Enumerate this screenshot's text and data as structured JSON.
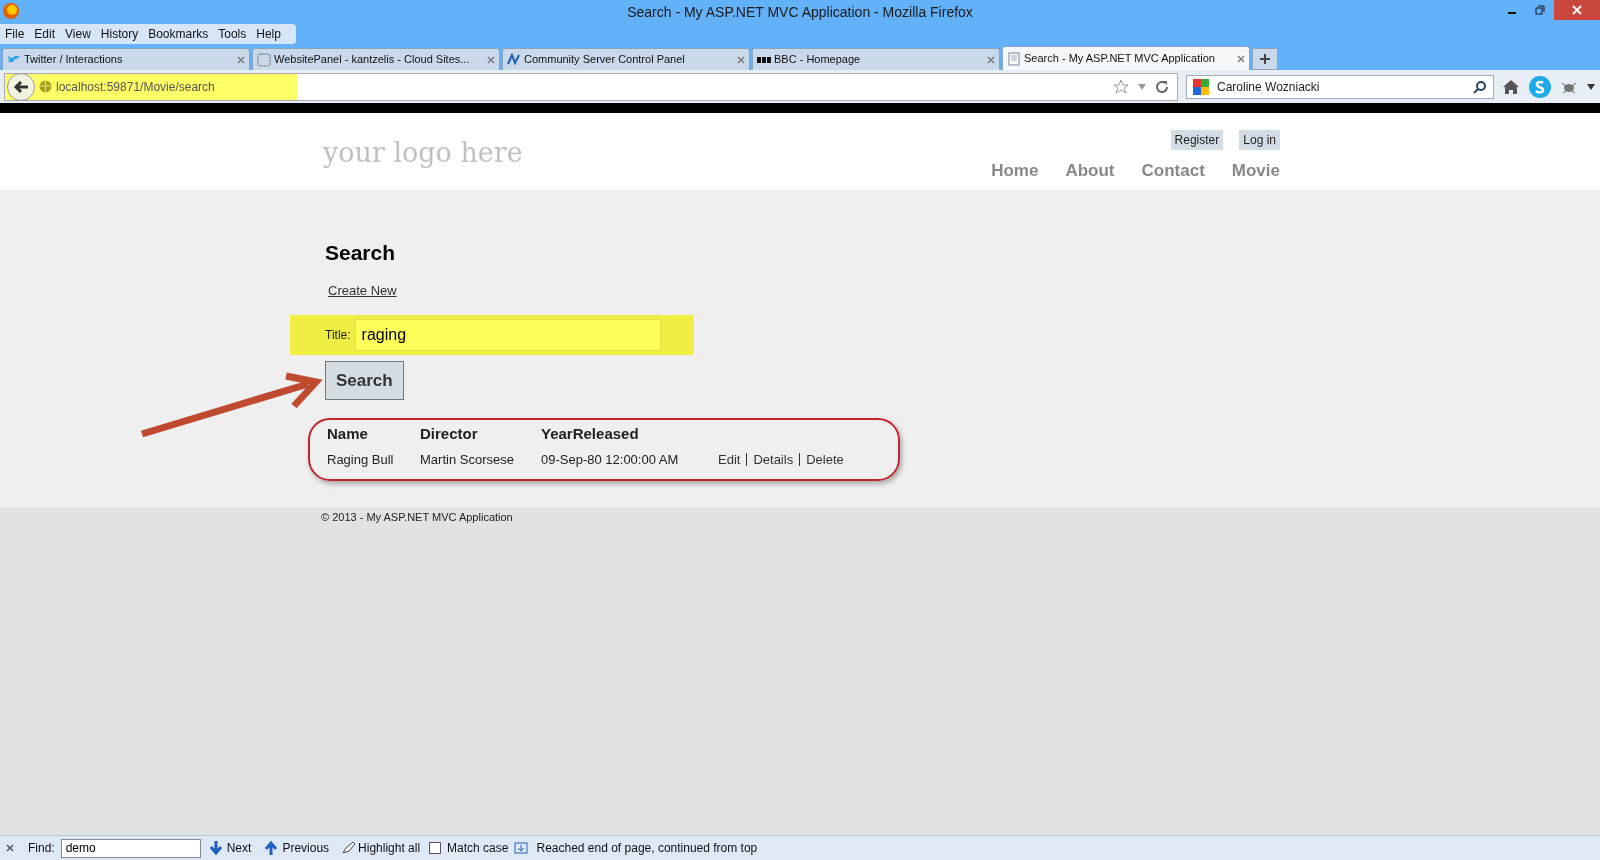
{
  "window": {
    "title": "Search - My ASP.NET MVC Application - Mozilla Firefox"
  },
  "menu": [
    "File",
    "Edit",
    "View",
    "History",
    "Bookmarks",
    "Tools",
    "Help"
  ],
  "tabs": [
    {
      "label": "Twitter / Interactions",
      "selected": false
    },
    {
      "label": "WebsitePanel - kantzelis - Cloud Sites...",
      "selected": false
    },
    {
      "label": "Community Server Control Panel",
      "selected": false
    },
    {
      "label": "BBC - Homepage",
      "selected": false
    },
    {
      "label": "Search - My ASP.NET MVC Application",
      "selected": true
    }
  ],
  "address_bar": {
    "url": "localhost:59871/Movie/search"
  },
  "search_box": {
    "value": "Caroline Wozniacki"
  },
  "site": {
    "logo": "your logo here",
    "login_links": [
      "Register",
      "Log in"
    ],
    "nav": [
      "Home",
      "About",
      "Contact",
      "Movie"
    ]
  },
  "page": {
    "heading": "Search",
    "create_link": "Create New",
    "field_label": "Title:",
    "field_value": "raging",
    "button": "Search",
    "table": {
      "columns": [
        "Name",
        "Director",
        "YearReleased"
      ],
      "rows": [
        {
          "cells": [
            "Raging Bull",
            "Martin Scorsese",
            "09-Sep-80 12:00:00 AM"
          ],
          "actions": [
            "Edit",
            "Details",
            "Delete"
          ]
        }
      ]
    }
  },
  "footer": "© 2013 - My ASP.NET MVC Application",
  "find_bar": {
    "label": "Find:",
    "value": "demo",
    "buttons": [
      "Next",
      "Previous",
      "Highlight all"
    ],
    "match_case": {
      "label": "Match case",
      "checked": false
    },
    "status": "Reached end of page, continued from top"
  }
}
